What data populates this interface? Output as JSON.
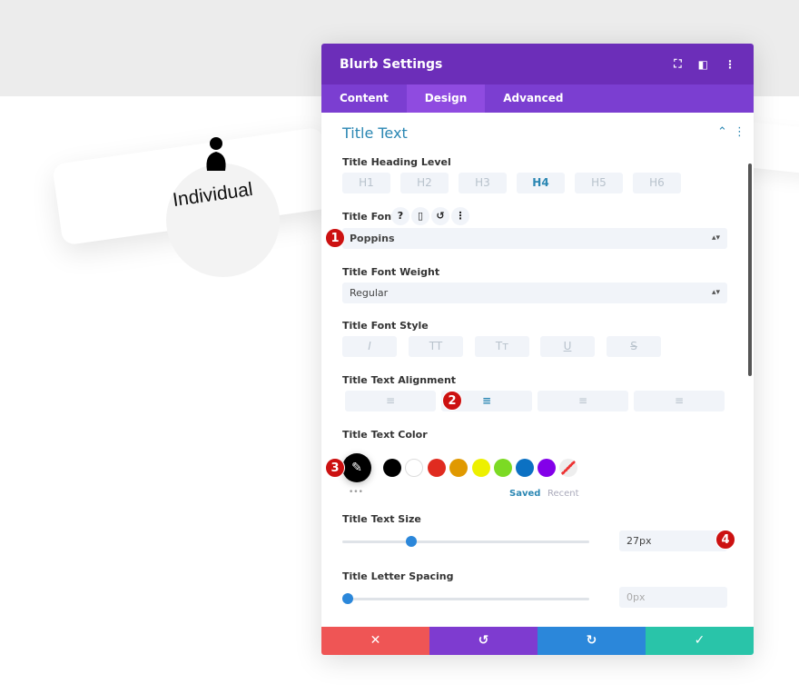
{
  "preview": {
    "title": "Individual"
  },
  "panel": {
    "title": "Blurb Settings",
    "tabs": [
      "Content",
      "Design",
      "Advanced"
    ],
    "active_tab": "Design"
  },
  "section": {
    "title": "Title Text"
  },
  "heading_level": {
    "label": "Title Heading Level",
    "options": [
      "H1",
      "H2",
      "H3",
      "H4",
      "H5",
      "H6"
    ],
    "selected": "H4"
  },
  "font": {
    "label": "Title Font",
    "value": "Poppins"
  },
  "weight": {
    "label": "Title Font Weight",
    "value": "Regular"
  },
  "style": {
    "label": "Title Font Style",
    "options": [
      "I",
      "TT",
      "Tт",
      "U",
      "S"
    ]
  },
  "alignment": {
    "label": "Title Text Alignment",
    "options": [
      "left",
      "center",
      "right",
      "justify"
    ],
    "selected": "center"
  },
  "color": {
    "label": "Title Text Color",
    "swatches": [
      "#000000",
      "#ffffff",
      "#e02b20",
      "#e09900",
      "#edf000",
      "#7cda24",
      "#0c71c3",
      "#8300e9"
    ],
    "saved": "Saved",
    "recent": "Recent",
    "more": "•••"
  },
  "size": {
    "label": "Title Text Size",
    "value": "27px",
    "slider_fraction": 0.27
  },
  "spacing": {
    "label": "Title Letter Spacing",
    "value": "0px",
    "slider_fraction": 0
  },
  "badges": [
    "1",
    "2",
    "3",
    "4"
  ],
  "footer_colors": {
    "cancel": "#ef5555",
    "undo": "#7e3bd0",
    "redo": "#2b87da",
    "save": "#29c4a9"
  },
  "accent": "#6c2eb9"
}
